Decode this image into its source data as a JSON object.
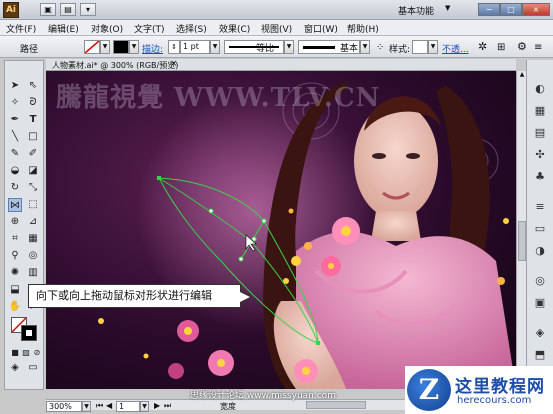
{
  "window": {
    "app_logo": "Ai",
    "workspace": "基本功能",
    "controls": [
      "−",
      "□",
      "×"
    ]
  },
  "menu": [
    "文件(F)",
    "编辑(E)",
    "对象(O)",
    "文字(T)",
    "选择(S)",
    "效果(C)",
    "视图(V)",
    "窗口(W)",
    "帮助(H)"
  ],
  "control_bar": {
    "selection_label": "路径",
    "stroke_link": "描边:",
    "stroke_weight": "1 pt",
    "profile_label": "等比",
    "brush_label": "基本",
    "style_label": "样式:",
    "opacity_link": "不透..."
  },
  "document": {
    "tab_label": "人物素材.ai* @ 300% (RGB/预览)",
    "close": "×",
    "watermark": "騰龍視覺 WWW.TLV.CN"
  },
  "tooltip": {
    "text": "向下或向上拖动鼠标对形状进行编辑"
  },
  "status": {
    "zoom": "300%",
    "page": "1",
    "tool_name": "宽度",
    "forum_mark": "思缘设计论坛 www.missyuan.com"
  },
  "brand": {
    "mark": "Z",
    "name": "这里教程网",
    "url": "herecours.com"
  },
  "colors": {
    "canvas_bg": "#2a0a2a",
    "path_stroke": "#3bd14a",
    "brand_blue": "#1e4ea8"
  }
}
